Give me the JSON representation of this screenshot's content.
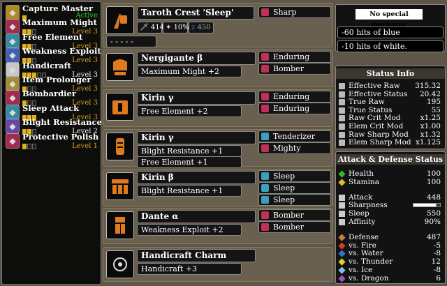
{
  "skills": [
    {
      "name": "Capture Master",
      "level": "Active",
      "filled": 1,
      "total": 1,
      "state": "active",
      "icon": "capture-icon",
      "color": "#c9a227"
    },
    {
      "name": "Maximum Might",
      "level": "Level 3",
      "filled": 2,
      "total": 3,
      "state": "partial",
      "icon": "might-icon",
      "color": "#c0305a"
    },
    {
      "name": "Free Element",
      "level": "Level 3",
      "filled": 2,
      "total": 3,
      "state": "partial",
      "icon": "element-icon",
      "color": "#3aa0c0"
    },
    {
      "name": "Weakness Exploit",
      "level": "Level 3",
      "filled": 2,
      "total": 3,
      "state": "partial",
      "icon": "weakness-icon",
      "color": "#4a70d0"
    },
    {
      "name": "Handicraft",
      "level": "Level 3",
      "filled": 3,
      "total": 5,
      "state": "max",
      "icon": "handicraft-icon",
      "color": "#e8e8e8"
    },
    {
      "name": "Item Prolonger",
      "level": "Level 3",
      "filled": 1,
      "total": 3,
      "state": "partial",
      "icon": "prolonger-icon",
      "color": "#c0a040"
    },
    {
      "name": "Bombardier",
      "level": "Level 3",
      "filled": 1,
      "total": 3,
      "state": "partial",
      "icon": "bomb-icon",
      "color": "#c0305a"
    },
    {
      "name": "Sleep Attack",
      "level": "Level 3",
      "filled": 3,
      "total": 3,
      "state": "partial",
      "icon": "sleep-icon",
      "color": "#3aa0c0"
    },
    {
      "name": "Blight Resistance",
      "level": "Level 2",
      "filled": 2,
      "total": 3,
      "state": "max",
      "icon": "blight-icon",
      "color": "#7a50c0"
    },
    {
      "name": "Protective Polish",
      "level": "Level 1",
      "filled": 1,
      "total": 3,
      "state": "partial",
      "icon": "polish-icon",
      "color": "#c0305a"
    }
  ],
  "weapon": {
    "name": "Taroth Crest 'Sleep'",
    "attack": "414",
    "affinity": "10%",
    "element": "450",
    "deco": {
      "name": "Sharp",
      "color": "#c0305a"
    },
    "slot": "- - - - -",
    "icon": "weapon-icon"
  },
  "armor": [
    {
      "name": "Nergigante β",
      "skills": [
        "Maximum Might +2"
      ],
      "decos": [
        {
          "name": "Enduring",
          "color": "#c0305a"
        },
        {
          "name": "Bomber",
          "color": "#c0305a"
        }
      ],
      "icon": "helm-icon"
    },
    {
      "name": "Kirin γ",
      "skills": [
        "Free Element +2"
      ],
      "decos": [
        {
          "name": "Enduring",
          "color": "#c0305a"
        },
        {
          "name": "Enduring",
          "color": "#c0305a"
        }
      ],
      "icon": "chest-icon"
    },
    {
      "name": "Kirin γ",
      "skills": [
        "Blight Resistance +1",
        "Free Element +1"
      ],
      "decos": [
        {
          "name": "Tenderizer",
          "color": "#3aa0c0"
        },
        {
          "name": "Mighty",
          "color": "#c0305a"
        }
      ],
      "icon": "arms-icon"
    },
    {
      "name": "Kirin β",
      "skills": [
        "Blight Resistance +1"
      ],
      "decos": [
        {
          "name": "Sleep",
          "color": "#3aa0c0"
        },
        {
          "name": "Sleep",
          "color": "#3aa0c0"
        },
        {
          "name": "Sleep",
          "color": "#3aa0c0"
        }
      ],
      "icon": "waist-icon"
    },
    {
      "name": "Dante α",
      "skills": [
        "Weakness Exploit +2"
      ],
      "decos": [
        {
          "name": "Bomber",
          "color": "#c0305a"
        },
        {
          "name": "Bomber",
          "color": "#c0305a"
        }
      ],
      "icon": "legs-icon"
    },
    {
      "name": "Handicraft Charm",
      "skills": [
        "Handicraft +3"
      ],
      "decos": [],
      "icon": "charm-icon"
    }
  ],
  "mechanic": {
    "title": "No special mechanic",
    "notes": [
      "-60 hits of blue",
      "-10 hits of white."
    ]
  },
  "status": {
    "title": "Status Info",
    "rows": [
      {
        "k": "Effective Raw",
        "v": "315.32"
      },
      {
        "k": "Effective Status",
        "v": "20.42"
      },
      {
        "k": "True Raw",
        "v": "195"
      },
      {
        "k": "True Status",
        "v": "55"
      },
      {
        "k": "Raw Crit Mod",
        "v": "x1.25"
      },
      {
        "k": "Elem Crit Mod",
        "v": "x1.00"
      },
      {
        "k": "Raw Sharp Mod",
        "v": "x1.32"
      },
      {
        "k": "Elem Sharp Mod",
        "v": "x1.125"
      }
    ]
  },
  "ad": {
    "title": "Attack & Defense Status",
    "vitals": [
      {
        "k": "Health",
        "v": "100",
        "color": "#2bbf2b"
      },
      {
        "k": "Stamina",
        "v": "100",
        "color": "#e0c020"
      }
    ],
    "attack": [
      {
        "k": "Attack",
        "v": "448"
      },
      {
        "k": "Sharpness",
        "v": ""
      },
      {
        "k": "Sleep",
        "v": "550"
      },
      {
        "k": "Affinity",
        "v": "90%"
      }
    ],
    "defense": [
      {
        "k": "Defense",
        "v": "487",
        "color": "#c08040"
      },
      {
        "k": "vs. Fire",
        "v": "-5",
        "color": "#d04020"
      },
      {
        "k": "vs. Water",
        "v": "-8",
        "color": "#3070d0"
      },
      {
        "k": "vs. Thunder",
        "v": "12",
        "color": "#e0d020"
      },
      {
        "k": "vs. Ice",
        "v": "-8",
        "color": "#80c0e0"
      },
      {
        "k": "vs. Dragon",
        "v": "6",
        "color": "#a050c0"
      }
    ]
  }
}
